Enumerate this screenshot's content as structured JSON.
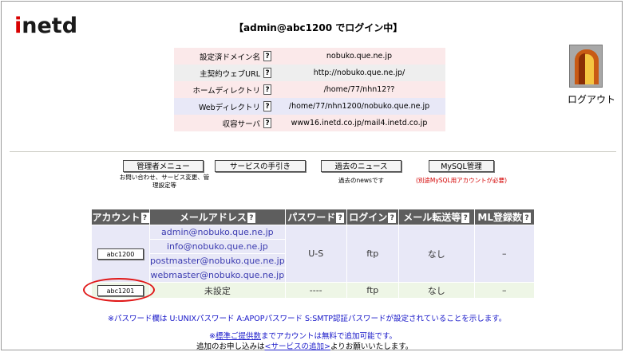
{
  "brand": {
    "first_letter": "i",
    "rest": "netd"
  },
  "login_title": "【admin@abc1200 でログイン中】",
  "info": [
    {
      "label": "設定済ドメイン名",
      "value": "nobuko.que.ne.jp"
    },
    {
      "label": "主契約ウェブURL",
      "value": "http://nobuko.que.ne.jp/"
    },
    {
      "label": "ホームディレクトリ",
      "value": "/home/77/nhn12??"
    },
    {
      "label": "Webディレクトリ",
      "value": "/home/77/nhn1200/nobuko.que.ne.jp"
    },
    {
      "label": "収容サーバ",
      "value": "www16.inetd.co.jp/mail4.inetd.co.jp"
    }
  ],
  "help_glyph": "?",
  "logout": {
    "label": "ログアウト",
    "icon": "door-exit-icon"
  },
  "nav": {
    "admin_menu": "管理者メニュー",
    "admin_note_1": "お問い合わせ、サービス変更、管",
    "admin_note_2": "理設定等",
    "service_guide": "サービスの手引き",
    "past_news": "過去のニュース",
    "past_news_note": "過去のnewsです",
    "mysql": "MySQL管理",
    "mysql_note": "(別途MySQL用アカウントが必要)"
  },
  "table": {
    "headers": [
      "アカウント",
      "メールアドレス",
      "パスワード",
      "ログイン",
      "メール転送等",
      "ML登録数"
    ],
    "account1": "abc1200",
    "emails": [
      "admin@nobuko.que.ne.jp",
      "info@nobuko.que.ne.jp",
      "postmaster@nobuko.que.ne.jp",
      "webmaster@nobuko.que.ne.jp"
    ],
    "row1": {
      "password": "U-S",
      "login": "ftp",
      "forward": "なし",
      "ml": "–"
    },
    "account2": "abc1201",
    "row2": {
      "email": "未設定",
      "password": "----",
      "login": "ftp",
      "forward": "なし",
      "ml": "–"
    }
  },
  "footer": {
    "password_note": "※パスワード欄は U:UNIXパスワード A:APOPパスワード S:SMTP認証パスワードが設定されていることを示します。",
    "line2_mark": "※",
    "line2_link": "標準ご提供数",
    "line2_rest": "までアカウントは無料で追加可能です。",
    "line3_pre": "追加のお申し込みは",
    "line3_link": "<サービスの追加>",
    "line3_post": "よりお願いいたします。"
  }
}
